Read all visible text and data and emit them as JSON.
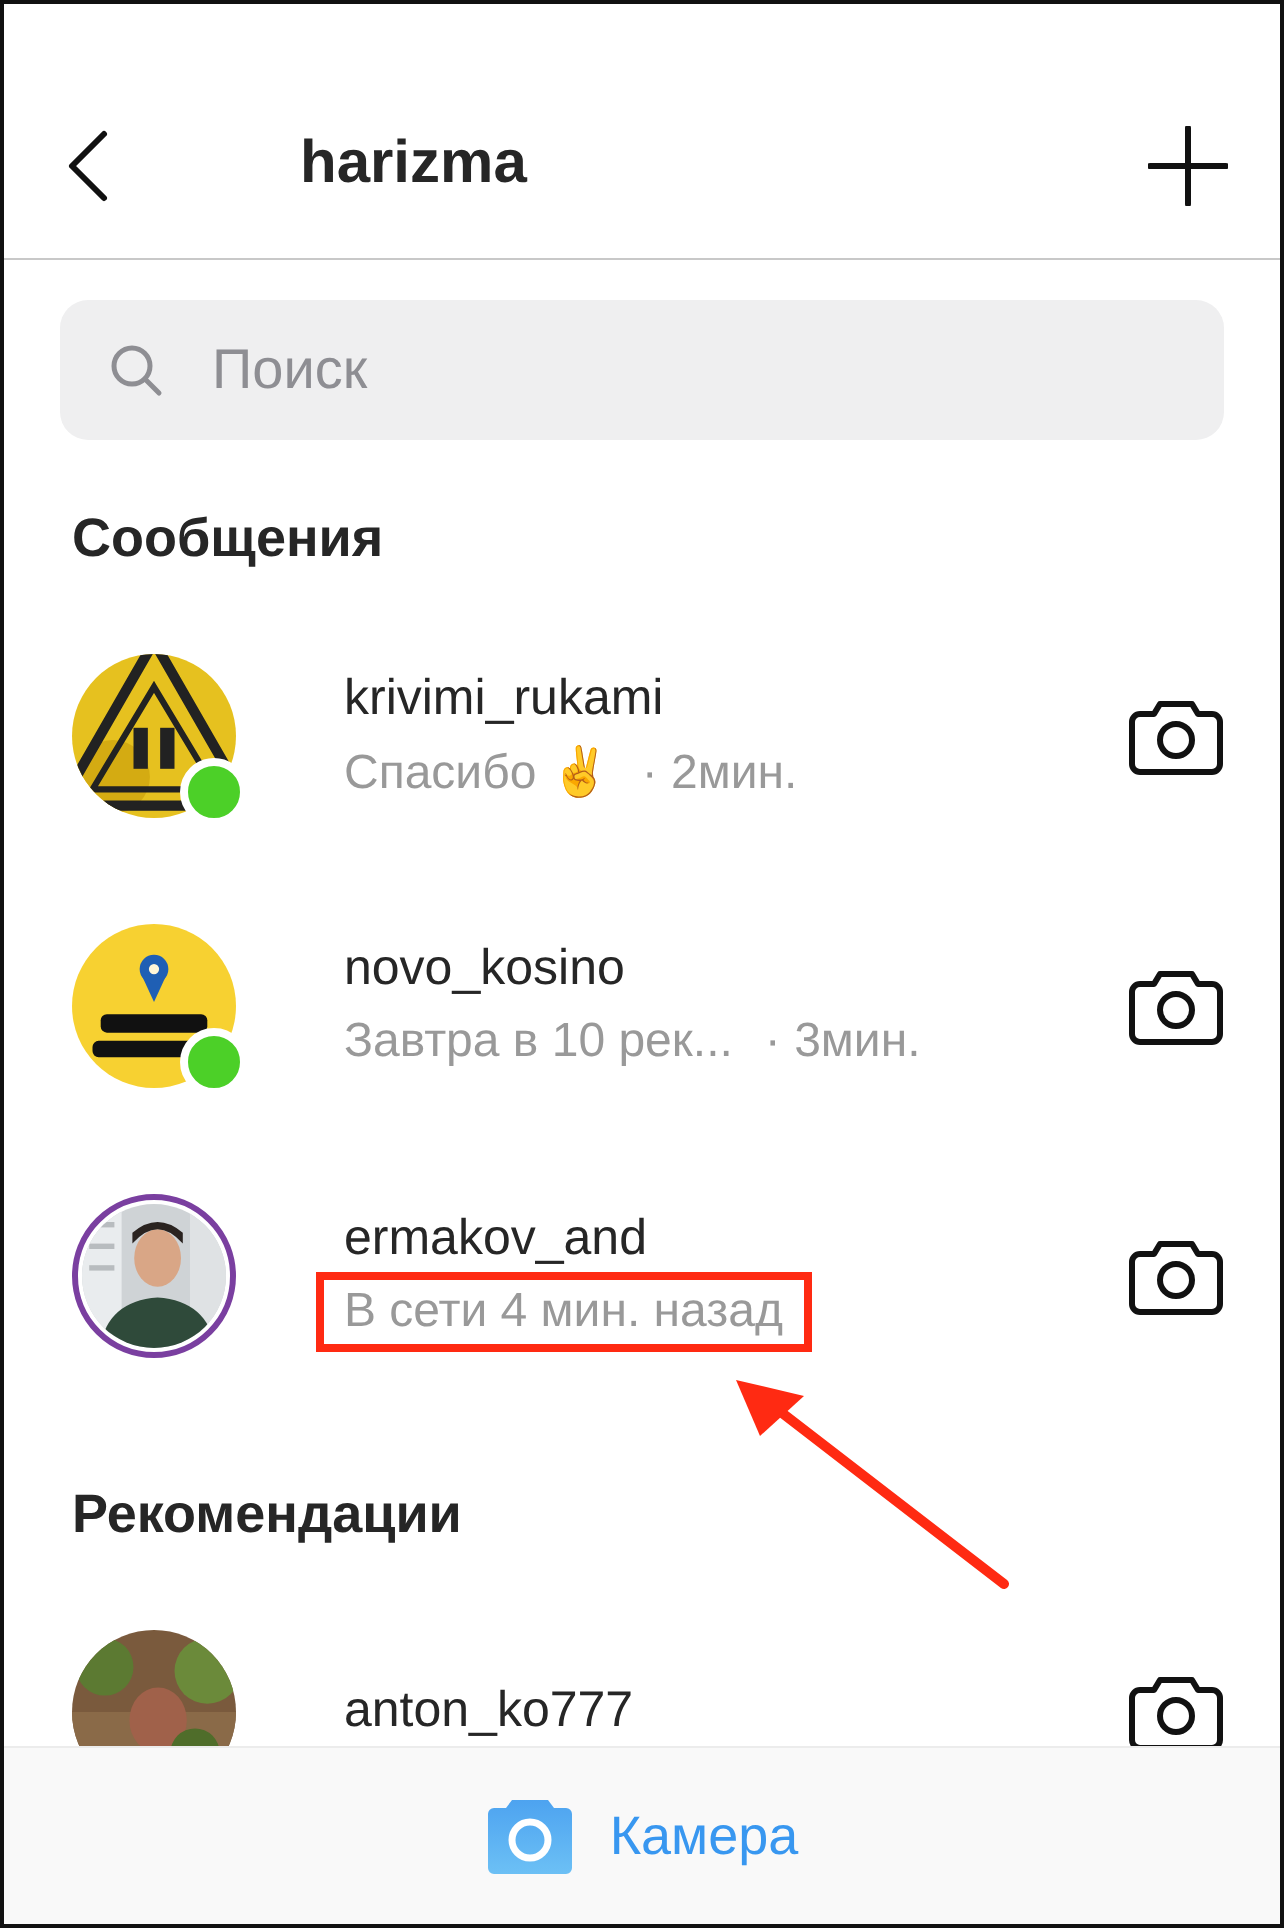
{
  "header": {
    "title": "harizma"
  },
  "search": {
    "placeholder": "Поиск"
  },
  "sections": [
    {
      "title": "Сообщения",
      "rows": [
        {
          "username": "krivimi_rukami",
          "preview": "Спасибо ✌️",
          "time": "· 2мин.",
          "online": true,
          "story": false,
          "highlighted": false
        },
        {
          "username": "novo_kosino",
          "preview": "Завтра в 10 рек...",
          "time": "· 3мин.",
          "online": true,
          "story": false,
          "highlighted": false
        },
        {
          "username": "ermakov_and",
          "preview": "В сети 4 мин. назад",
          "online": false,
          "story": true,
          "highlighted": true
        }
      ]
    },
    {
      "title": "Рекомендации",
      "rows": [
        {
          "username": "anton_ko777",
          "online": false,
          "story": false,
          "highlighted": false
        }
      ]
    }
  ],
  "bottom_bar": {
    "label": "Камера"
  }
}
